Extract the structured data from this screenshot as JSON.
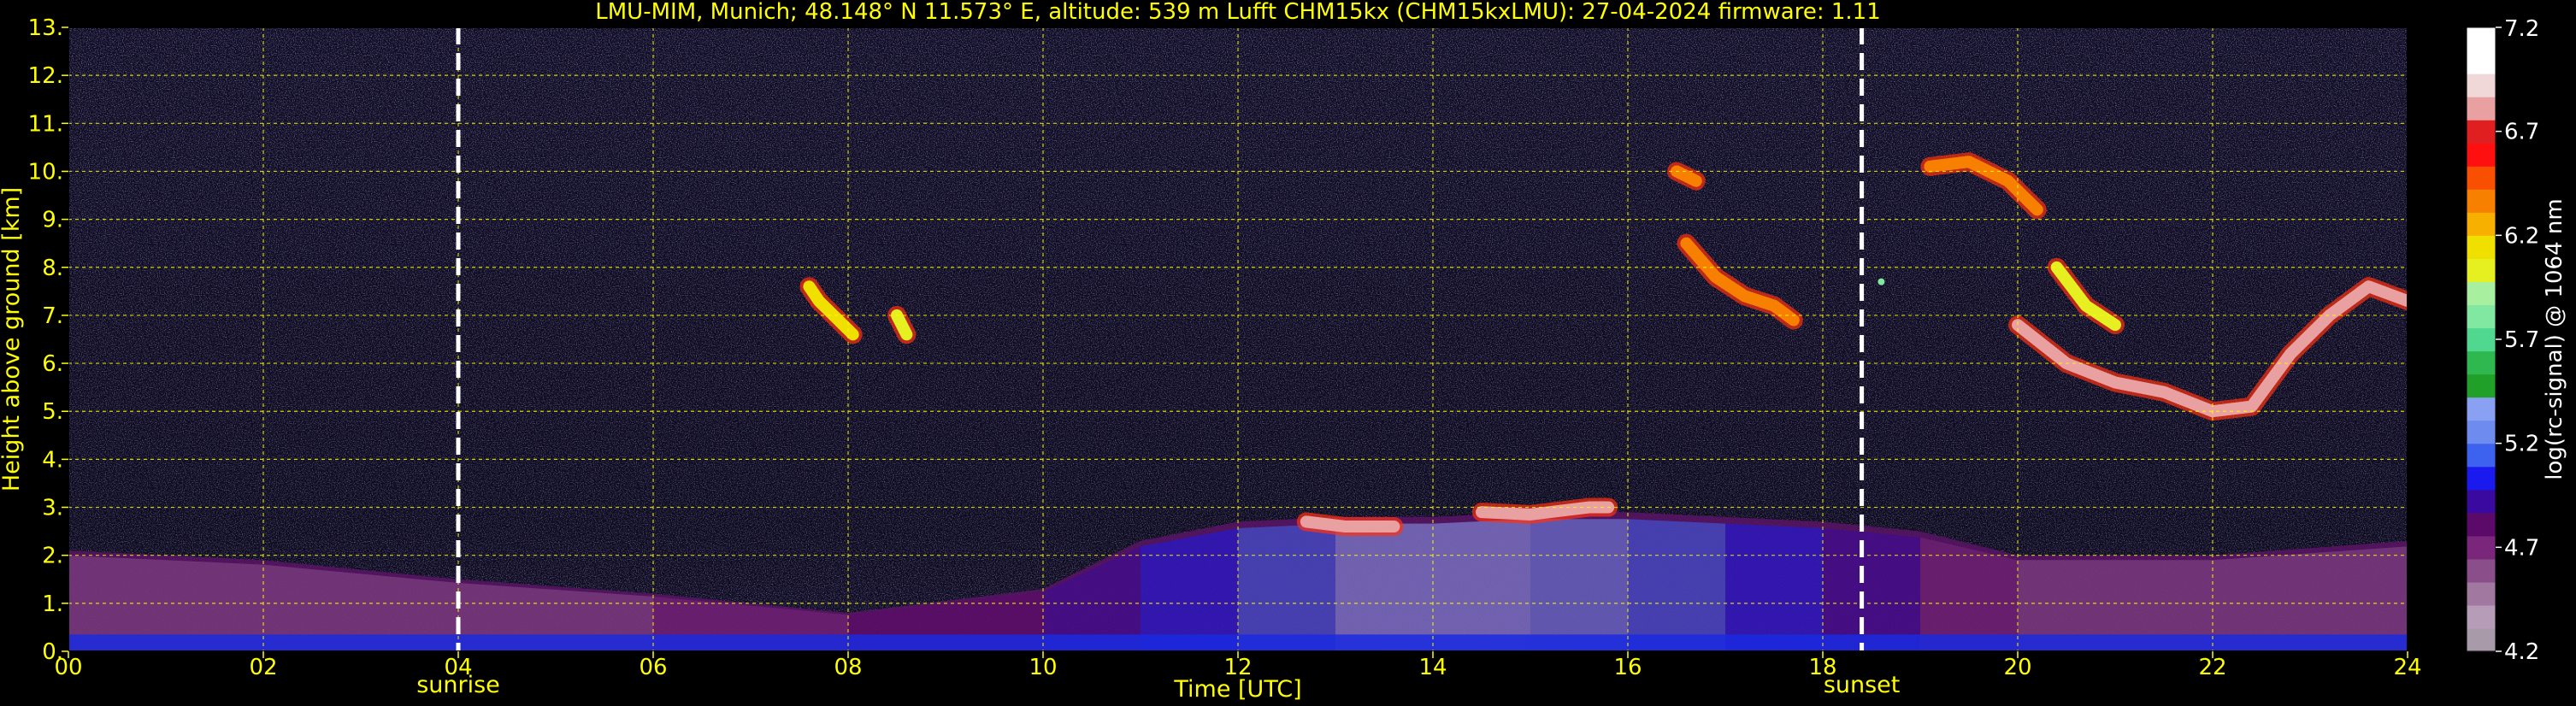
{
  "chart_data": {
    "type": "heatmap",
    "title": "LMU-MIM, Munich; 48.148° N 11.573° E, altitude: 539 m    Lufft CHM15kx (CHM15kxLMU): 27-04-2024    firmware: 1.11",
    "xlabel": "Time [UTC]",
    "ylabel": "Height above ground [km]",
    "xlim": [
      0,
      24
    ],
    "ylim": [
      0,
      13
    ],
    "x_tick_labels": [
      "00",
      "02",
      "04",
      "06",
      "08",
      "10",
      "12",
      "14",
      "16",
      "18",
      "20",
      "22",
      "24"
    ],
    "y_tick_labels": [
      "0.",
      "1.",
      "2.",
      "3.",
      "4.",
      "5.",
      "6.",
      "7.",
      "8.",
      "9.",
      "10.",
      "11.",
      "12.",
      "13."
    ],
    "grid": true,
    "markers": [
      {
        "label": "sunrise",
        "x": 4.0
      },
      {
        "label": "sunset",
        "x": 18.4
      }
    ],
    "colorbar": {
      "label": "log(rc-signal) @ 1064 nm",
      "range": [
        4.2,
        7.2
      ],
      "tick_labels": [
        "4.2",
        "4.7",
        "5.2",
        "5.7",
        "6.2",
        "6.7",
        "7.2"
      ],
      "tick_values": [
        4.2,
        4.7,
        5.2,
        5.7,
        6.2,
        6.7,
        7.2
      ],
      "colors": [
        "#a89aa8",
        "#b69cb6",
        "#a078a0",
        "#8a4e8a",
        "#7a267a",
        "#5c0a6a",
        "#3a0aa0",
        "#1a1aee",
        "#3e62f0",
        "#6e8cf0",
        "#8aa0f2",
        "#20a028",
        "#30b850",
        "#50d890",
        "#80e8a0",
        "#a8f0a0",
        "#e6f020",
        "#f0e000",
        "#f8b000",
        "#f88000",
        "#f85000",
        "#ff1010",
        "#e02020",
        "#e8a0a0",
        "#f0d8d8",
        "#ffffff",
        "#ffffff"
      ]
    },
    "features": {
      "boundary_layer": [
        {
          "t": 0,
          "top": 2.1,
          "intensity": 4.6
        },
        {
          "t": 2,
          "top": 1.9,
          "intensity": 4.6
        },
        {
          "t": 4,
          "top": 1.5,
          "intensity": 4.6
        },
        {
          "t": 6,
          "top": 1.2,
          "intensity": 4.6
        },
        {
          "t": 8,
          "top": 0.8,
          "intensity": 4.7
        },
        {
          "t": 10,
          "top": 1.3,
          "intensity": 4.8
        },
        {
          "t": 11,
          "top": 2.3,
          "intensity": 4.9
        },
        {
          "t": 12,
          "top": 2.7,
          "intensity": 5.0
        },
        {
          "t": 13,
          "top": 2.8,
          "intensity": 5.3
        },
        {
          "t": 14,
          "top": 2.8,
          "intensity": 5.3
        },
        {
          "t": 15,
          "top": 2.9,
          "intensity": 5.3
        },
        {
          "t": 16,
          "top": 2.9,
          "intensity": 5.2
        },
        {
          "t": 17,
          "top": 2.8,
          "intensity": 5.0
        },
        {
          "t": 18,
          "top": 2.7,
          "intensity": 4.9
        },
        {
          "t": 19,
          "top": 2.5,
          "intensity": 4.8
        },
        {
          "t": 20,
          "top": 2.0,
          "intensity": 4.6
        },
        {
          "t": 22,
          "top": 2.0,
          "intensity": 4.6
        },
        {
          "t": 24,
          "top": 2.3,
          "intensity": 4.6
        }
      ],
      "cloud_layers": [
        {
          "x": [
            7.6,
            7.7,
            7.9,
            8.05
          ],
          "y": [
            7.6,
            7.3,
            6.9,
            6.6
          ],
          "intensity": 6.2
        },
        {
          "x": [
            8.5,
            8.6
          ],
          "y": [
            7.0,
            6.6
          ],
          "intensity": 6.0
        },
        {
          "x": [
            12.7,
            13.1,
            13.6
          ],
          "y": [
            2.7,
            2.6,
            2.6
          ],
          "intensity": 6.8
        },
        {
          "x": [
            14.5,
            15.0,
            15.6,
            15.8
          ],
          "y": [
            2.9,
            2.85,
            3.0,
            3.0
          ],
          "intensity": 6.8
        },
        {
          "x": [
            16.5,
            16.7
          ],
          "y": [
            10.0,
            9.8
          ],
          "intensity": 6.4
        },
        {
          "x": [
            16.6,
            16.9,
            17.2,
            17.5,
            17.7
          ],
          "y": [
            8.5,
            7.8,
            7.4,
            7.2,
            6.9
          ],
          "intensity": 6.4
        },
        {
          "x": [
            18.6
          ],
          "y": [
            7.7
          ],
          "intensity": 5.8
        },
        {
          "x": [
            19.1,
            19.5,
            19.9,
            20.2
          ],
          "y": [
            10.1,
            10.2,
            9.8,
            9.2
          ],
          "intensity": 6.4
        },
        {
          "x": [
            20.0,
            20.5,
            21.0,
            21.5,
            22.0,
            22.4,
            22.8,
            23.2,
            23.6,
            24.0
          ],
          "y": [
            6.8,
            6.0,
            5.6,
            5.4,
            5.0,
            5.1,
            6.2,
            7.0,
            7.6,
            7.3
          ],
          "intensity": 6.9
        },
        {
          "x": [
            20.4,
            20.7,
            21.0
          ],
          "y": [
            8.0,
            7.2,
            6.8
          ],
          "intensity": 6.0
        }
      ]
    }
  }
}
